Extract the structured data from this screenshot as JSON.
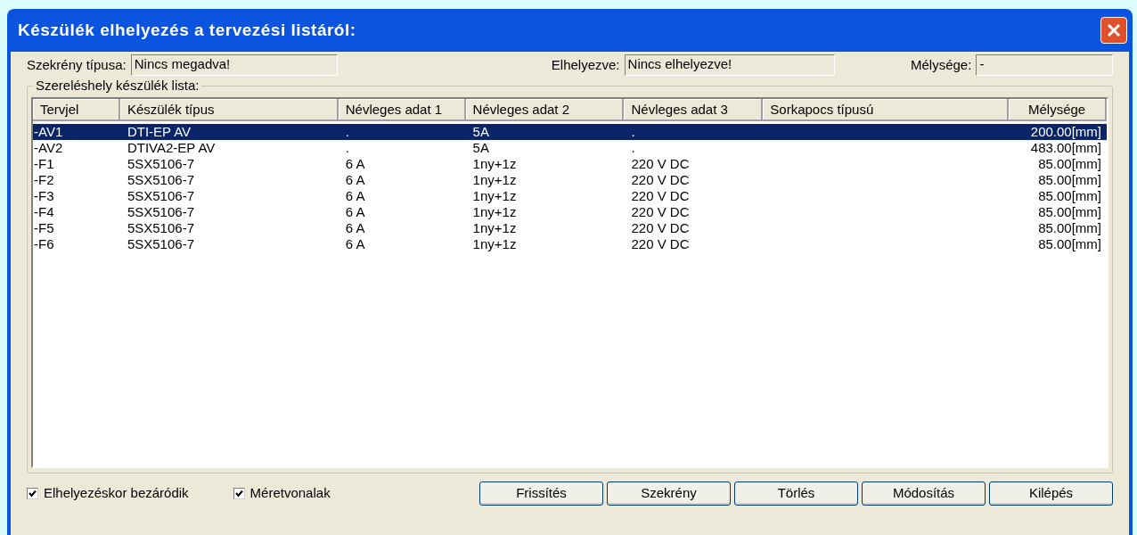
{
  "window": {
    "title": "Készülék elhelyezés a tervezési listáról:"
  },
  "info": [
    {
      "label": "Szekrény típusa:",
      "value": "Nincs megadva!"
    },
    {
      "label": "Elhelyezve:",
      "value": "Nincs elhelyezve!"
    },
    {
      "label": "Mélysége:",
      "value": "-"
    }
  ],
  "group": {
    "title": "Szereléshely készülék lista:"
  },
  "table": {
    "columns": [
      "Tervjel",
      "Készülék típus",
      "Névleges adat 1",
      "Névleges adat 2",
      "Névleges adat 3",
      "Sorkapocs típusú",
      "Mélysége"
    ],
    "rows": [
      {
        "selected": true,
        "cells": [
          "-AV1",
          "DTI-EP AV",
          ".",
          "5A",
          ".",
          "",
          "200.00[mm]"
        ]
      },
      {
        "selected": false,
        "cells": [
          "-AV2",
          "DTIVA2-EP AV",
          ".",
          "5A",
          ".",
          "",
          "483.00[mm]"
        ]
      },
      {
        "selected": false,
        "cells": [
          "-F1",
          "5SX5106-7",
          "6 A",
          "1ny+1z",
          "220 V DC",
          "",
          "85.00[mm]"
        ]
      },
      {
        "selected": false,
        "cells": [
          "-F2",
          "5SX5106-7",
          "6 A",
          "1ny+1z",
          "220 V DC",
          "",
          "85.00[mm]"
        ]
      },
      {
        "selected": false,
        "cells": [
          "-F3",
          "5SX5106-7",
          "6 A",
          "1ny+1z",
          "220 V DC",
          "",
          "85.00[mm]"
        ]
      },
      {
        "selected": false,
        "cells": [
          "-F4",
          "5SX5106-7",
          "6 A",
          "1ny+1z",
          "220 V DC",
          "",
          "85.00[mm]"
        ]
      },
      {
        "selected": false,
        "cells": [
          "-F5",
          "5SX5106-7",
          "6 A",
          "1ny+1z",
          "220 V DC",
          "",
          "85.00[mm]"
        ]
      },
      {
        "selected": false,
        "cells": [
          "-F6",
          "5SX5106-7",
          "6 A",
          "1ny+1z",
          "220 V DC",
          "",
          "85.00[mm]"
        ]
      }
    ]
  },
  "checkboxes": [
    {
      "label": "Elhelyezéskor bezáródik",
      "checked": true
    },
    {
      "label": "Méretvonalak",
      "checked": true
    }
  ],
  "buttons": [
    "Frissítés",
    "Szekrény",
    "Törlés",
    "Módosítás",
    "Kilépés"
  ]
}
